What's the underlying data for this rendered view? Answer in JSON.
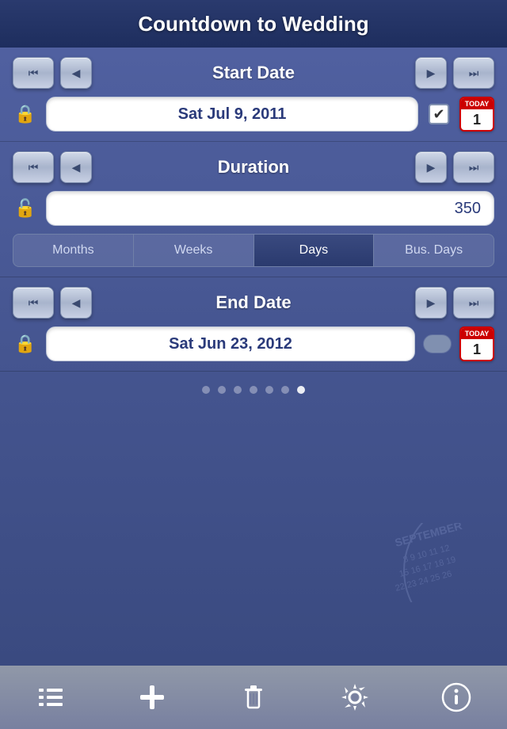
{
  "header": {
    "title": "Countdown to Wedding"
  },
  "start_date_section": {
    "label": "Start Date",
    "date_value": "Sat Jul 9, 2011",
    "btn_fast_back": "⏮",
    "btn_back": "◀",
    "btn_forward": "▶",
    "btn_fast_forward": "⏭",
    "today_label": "TODAY",
    "today_num": "1",
    "checkbox_checked": true
  },
  "duration_section": {
    "label": "Duration",
    "value": "350",
    "btn_fast_back": "⏮",
    "btn_back": "◀",
    "btn_forward": "▶",
    "btn_fast_forward": "⏭"
  },
  "unit_tabs": [
    {
      "label": "Months",
      "active": false
    },
    {
      "label": "Weeks",
      "active": false
    },
    {
      "label": "Days",
      "active": true
    },
    {
      "label": "Bus. Days",
      "active": false
    }
  ],
  "end_date_section": {
    "label": "End Date",
    "date_value": "Sat Jun 23, 2012",
    "btn_fast_back": "⏮",
    "btn_back": "◀",
    "btn_forward": "▶",
    "btn_fast_forward": "⏭",
    "today_label": "TODAY",
    "today_num": "1"
  },
  "page_dots": {
    "total": 7,
    "active_index": 6
  },
  "toolbar": {
    "list_label": "List",
    "add_label": "Add",
    "delete_label": "Delete",
    "settings_label": "Settings",
    "info_label": "Info"
  }
}
